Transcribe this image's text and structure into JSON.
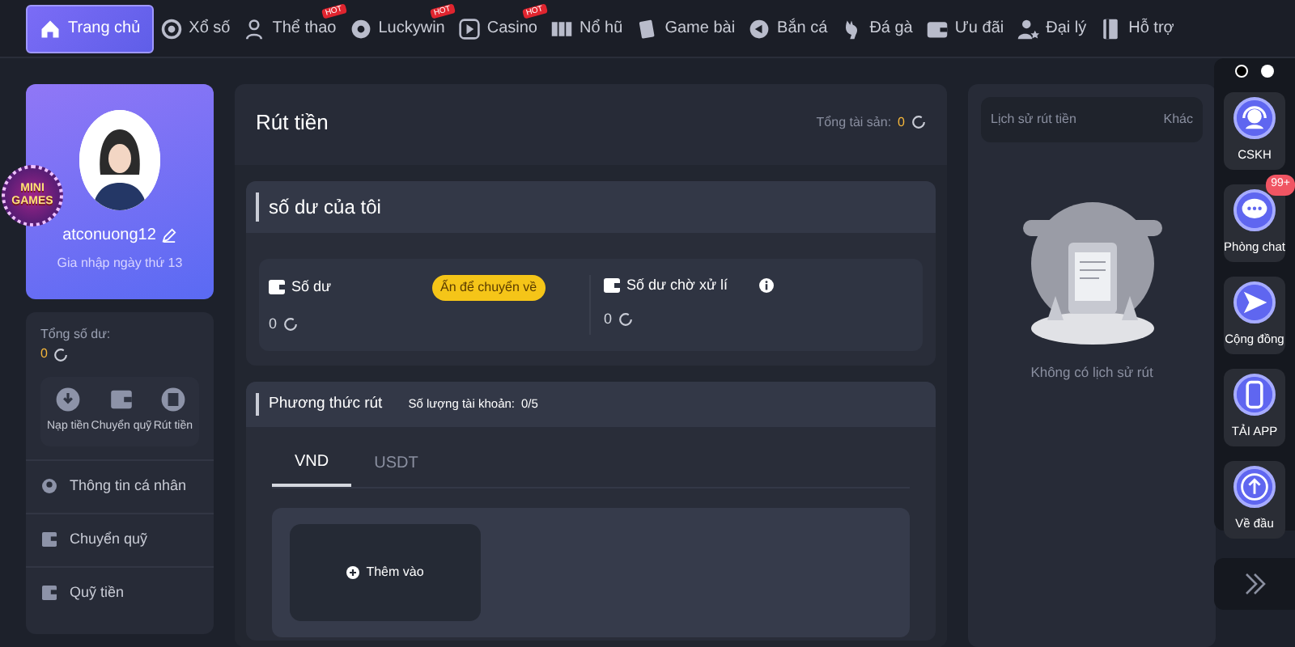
{
  "nav": [
    {
      "label": "Trang chủ",
      "selected": true
    },
    {
      "label": "Xổ số",
      "selected": false
    },
    {
      "label": "Thể thao",
      "selected": false,
      "badge": "HOT"
    },
    {
      "label": "Luckywin",
      "selected": false,
      "badge": "HOT"
    },
    {
      "label": "Casino",
      "selected": false,
      "badge": "HOT"
    },
    {
      "label": "Nổ hũ",
      "selected": false
    },
    {
      "label": "Game bài",
      "selected": false
    },
    {
      "label": "Bắn cá",
      "selected": false
    },
    {
      "label": "Đá gà",
      "selected": false
    },
    {
      "label": "Ưu đãi",
      "selected": false
    },
    {
      "label": "Đại lý",
      "selected": false
    },
    {
      "label": "Hỗ trợ",
      "selected": false
    }
  ],
  "mini_games": {
    "line_1": "MINI",
    "line_2": "GAMES"
  },
  "profile": {
    "username": "atconuong12",
    "joined": "Gia nhập ngày thứ 13"
  },
  "wallet": {
    "label": "Tổng số dư:",
    "value": "0",
    "actions": [
      "Nạp tiền",
      "Chuyển quỹ",
      "Rút tiền"
    ]
  },
  "menu": [
    "Thông tin cá nhân",
    "Chuyển quỹ",
    "Quỹ tiền"
  ],
  "withdraw": {
    "title": "Rút tiền",
    "total_label": "Tổng tài sản:",
    "total_value": "0",
    "balance_section": {
      "title": "số dư của tôi",
      "balance": {
        "label": "Số dư",
        "button": "Ấn để chuyển về",
        "value": "0"
      },
      "pending": {
        "label": "Số dư chờ xử lí",
        "value": "0"
      }
    },
    "method_section": {
      "title": "Phương thức rút",
      "count_label": "Số lượng tài khoản:",
      "count_value": "0/5",
      "tabs": [
        {
          "label": "VND",
          "selected": true
        },
        {
          "label": "USDT",
          "selected": false
        }
      ],
      "add_label": "Thêm vào"
    }
  },
  "history": {
    "title": "Lịch sử rút tiền",
    "other": "Khác",
    "empty": "Không có lịch sử rút"
  },
  "float_bar": [
    {
      "label": "CSKH"
    },
    {
      "label": "Phòng chat",
      "badge": "99+"
    },
    {
      "label": "Cộng đồng"
    },
    {
      "label": "TẢI APP"
    },
    {
      "label": "Về đầu"
    }
  ]
}
